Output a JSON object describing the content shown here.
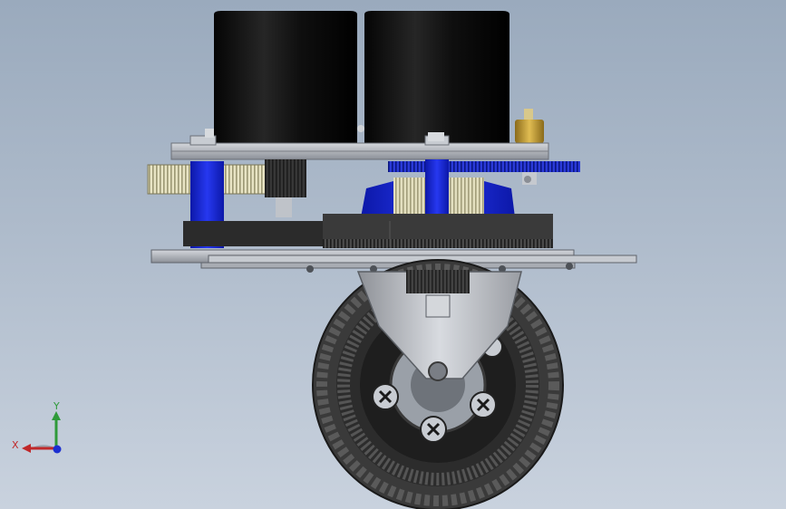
{
  "viewport": {
    "background_top": "#9aaabd",
    "background_bottom": "#c9d2de"
  },
  "model": {
    "parts": [
      {
        "name": "motor-left",
        "color": "#111111"
      },
      {
        "name": "motor-right",
        "color": "#111111"
      },
      {
        "name": "top-plate",
        "color": "#9ea3ab"
      },
      {
        "name": "drive-gear-left",
        "color": "#d9d6b8"
      },
      {
        "name": "drive-gear-right",
        "color": "#1e2fb8"
      },
      {
        "name": "standoff-left",
        "color": "#1a2ad6"
      },
      {
        "name": "standoff-right",
        "color": "#1a2ad6"
      },
      {
        "name": "bearing-housing",
        "color": "#1a2ad6"
      },
      {
        "name": "slew-bearing",
        "color": "#2d2d2d"
      },
      {
        "name": "base-plate",
        "color": "#b8bcc4"
      },
      {
        "name": "caster-fork",
        "color": "#b5b8be"
      },
      {
        "name": "wheel-tire",
        "color": "#3a3a3a"
      },
      {
        "name": "wheel-hub",
        "color": "#1f1f1f"
      },
      {
        "name": "brass-connector",
        "color": "#c8a032"
      }
    ]
  },
  "triad": {
    "x_label": "X",
    "y_label": "Y",
    "x_color": "#c0282a",
    "y_color": "#2f9a3a",
    "z_color": "#1c2fd0"
  }
}
